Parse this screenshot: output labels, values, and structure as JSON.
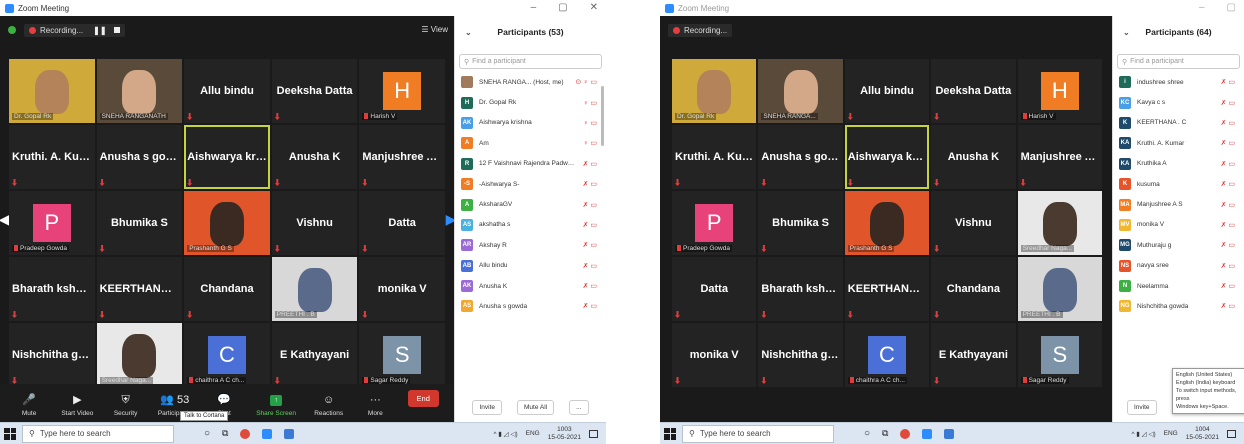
{
  "colors": {
    "accent": "#2d8cff",
    "end": "#d0382d",
    "active_speaker": "#c5d33c",
    "muted": "#e23b3b",
    "share": "#24a148"
  },
  "left": {
    "title": "Zoom Meeting",
    "recording": "Recording...",
    "view": "View",
    "participants_title": "Participants (53)",
    "search_placeholder": "Find a participant",
    "grid": [
      {
        "kind": "photo",
        "label": "Dr. Gopal Rk",
        "bg": "#cfa93a",
        "face": "#b5835a"
      },
      {
        "kind": "photo",
        "label": "SNEHA RANGANATH",
        "bg": "#5a4a3a",
        "face": "#d3a888"
      },
      {
        "kind": "name",
        "name": "Allu bindu"
      },
      {
        "kind": "name",
        "name": "Deeksha Datta"
      },
      {
        "kind": "avatar",
        "letter": "H",
        "color": "#f07c24",
        "label": "Harish V"
      },
      {
        "kind": "name",
        "name": "Kruthi. A. Kumar"
      },
      {
        "kind": "name",
        "name": "Anusha s gowda"
      },
      {
        "kind": "name",
        "name": "Aishwarya krish...",
        "active": true
      },
      {
        "kind": "name",
        "name": "Anusha K"
      },
      {
        "kind": "name",
        "name": "Manjushree A S"
      },
      {
        "kind": "avatar",
        "letter": "P",
        "color": "#e8427a",
        "label": "Pradeep Gowda"
      },
      {
        "kind": "name",
        "name": "Bhumika S"
      },
      {
        "kind": "photo",
        "label": "Prashanth G S",
        "bg": "#e0562a",
        "face": "#3a2a22"
      },
      {
        "kind": "name",
        "name": "Vishnu"
      },
      {
        "kind": "name",
        "name": "Datta"
      },
      {
        "kind": "name",
        "name": "Bharath kshatri..."
      },
      {
        "kind": "name",
        "name": "KEERTHANA . C"
      },
      {
        "kind": "name",
        "name": "Chandana"
      },
      {
        "kind": "photo",
        "label": "PREETHI . B",
        "bg": "#d8d8d8",
        "face": "#5a6a8a"
      },
      {
        "kind": "name",
        "name": "monika V"
      },
      {
        "kind": "name",
        "name": "Nishchitha gow..."
      },
      {
        "kind": "photo",
        "label": "Sreedhar Naga...",
        "bg": "#e8e8e8",
        "face": "#4a3a30"
      },
      {
        "kind": "avatar",
        "letter": "C",
        "color": "#4a6fd6",
        "label": "chaithra A C ch..."
      },
      {
        "kind": "name",
        "name": "E Kathyayani"
      },
      {
        "kind": "avatar",
        "letter": "S",
        "color": "#7d93a8",
        "label": "Sagar Reddy"
      }
    ],
    "toolbar": [
      {
        "icon": "🎤",
        "label": "Mute"
      },
      {
        "icon": "▶",
        "label": "Start Video"
      },
      {
        "icon": "⛨",
        "label": "Security"
      },
      {
        "icon": "👥 53",
        "label": "Participants"
      },
      {
        "icon": "💬",
        "label": "Chat"
      },
      {
        "icon": "↑",
        "label": "Share Screen"
      },
      {
        "icon": "☺",
        "label": "Reactions"
      },
      {
        "icon": "···",
        "label": "More"
      }
    ],
    "end": "End",
    "tooltip": "Talk to Cortana",
    "participants": [
      {
        "initials": "",
        "color": "#a07a5a",
        "name": "SNEHA RANGA... (Host, me)",
        "icons": "⊙ ♀ ▭"
      },
      {
        "initials": "H",
        "color": "#1f6b5a",
        "name": "Dr. Gopal Rk",
        "icons": "♀ ▭"
      },
      {
        "initials": "AK",
        "color": "#4a9ee8",
        "name": "Aishwarya krishna",
        "icons": "♀ ▭"
      },
      {
        "initials": "A",
        "color": "#f07c24",
        "name": "Am",
        "icons": "♀ ▭"
      },
      {
        "initials": "R",
        "color": "#1f6b5a",
        "name": "12 F Vaishnavi Rajendra Padwa...",
        "icons": "✗ ▭"
      },
      {
        "initials": "-S",
        "color": "#f07c24",
        "name": "-Aishwarya S-",
        "icons": "✗ ▭"
      },
      {
        "initials": "A",
        "color": "#3cb043",
        "name": "AksharaGV",
        "icons": "✗ ▭"
      },
      {
        "initials": "AS",
        "color": "#4ab0e0",
        "name": "akshatha s",
        "icons": "✗ ▭"
      },
      {
        "initials": "AR",
        "color": "#9a6ad6",
        "name": "Akshay R",
        "icons": "✗ ▭"
      },
      {
        "initials": "AB",
        "color": "#4a6fd6",
        "name": "Allu bindu",
        "icons": "✗ ▭"
      },
      {
        "initials": "AK",
        "color": "#9a6ad6",
        "name": "Anusha K",
        "icons": "✗ ▭"
      },
      {
        "initials": "AS",
        "color": "#f0a830",
        "name": "Anusha s gowda",
        "icons": "✗ ▭"
      }
    ],
    "invite": "Invite",
    "mute_all": "Mute All",
    "more": "...",
    "taskbar_search": "Type here to search",
    "lang": "ENG",
    "time": "1003",
    "date": "15-05-2021"
  },
  "right": {
    "title": "Zoom Meeting",
    "recording": "Recording...",
    "participants_title": "Participants (64)",
    "search_placeholder": "Find a participant",
    "grid": [
      {
        "kind": "photo",
        "label": "Dr. Gopal Rk",
        "bg": "#cfa93a",
        "face": "#b5835a"
      },
      {
        "kind": "photo",
        "label": "SNEHA RANGA...",
        "bg": "#5a4a3a",
        "face": "#d3a888"
      },
      {
        "kind": "name",
        "name": "Allu bindu"
      },
      {
        "kind": "name",
        "name": "Deeksha Datta"
      },
      {
        "kind": "avatar",
        "letter": "H",
        "color": "#f07c24",
        "label": "Harish V"
      },
      {
        "kind": "name",
        "name": "Kruthi. A. Kumar"
      },
      {
        "kind": "name",
        "name": "Anusha s gowda"
      },
      {
        "kind": "name",
        "name": "Aishwarya krish...",
        "active": true
      },
      {
        "kind": "name",
        "name": "Anusha K"
      },
      {
        "kind": "name",
        "name": "Manjushree A S"
      },
      {
        "kind": "avatar",
        "letter": "P",
        "color": "#e8427a",
        "label": "Pradeep Gowda"
      },
      {
        "kind": "name",
        "name": "Bhumika S"
      },
      {
        "kind": "photo",
        "label": "Prashanth G S",
        "bg": "#e0562a",
        "face": "#3a2a22"
      },
      {
        "kind": "name",
        "name": "Vishnu"
      },
      {
        "kind": "photo",
        "label": "Sreedhar Naga...",
        "bg": "#e8e8e8",
        "face": "#4a3a30"
      },
      {
        "kind": "name",
        "name": "Datta"
      },
      {
        "kind": "name",
        "name": "Bharath kshatri..."
      },
      {
        "kind": "name",
        "name": "KEERTHANA . C"
      },
      {
        "kind": "name",
        "name": "Chandana"
      },
      {
        "kind": "photo",
        "label": "PREETHI . B",
        "bg": "#d8d8d8",
        "face": "#5a6a8a"
      },
      {
        "kind": "name",
        "name": "monika V"
      },
      {
        "kind": "name",
        "name": "Nishchitha gow..."
      },
      {
        "kind": "avatar",
        "letter": "C",
        "color": "#4a6fd6",
        "label": "chaithra A C ch..."
      },
      {
        "kind": "name",
        "name": "E Kathyayani"
      },
      {
        "kind": "avatar",
        "letter": "S",
        "color": "#7d93a8",
        "label": "Sagar Reddy"
      }
    ],
    "participants": [
      {
        "initials": "i",
        "color": "#1f6b5a",
        "name": "indushree shree",
        "icons": "✗ ▭"
      },
      {
        "initials": "KC",
        "color": "#4a9ee8",
        "name": "Kavya c s",
        "icons": "✗ ▭"
      },
      {
        "initials": "K",
        "color": "#1f4a6b",
        "name": "KEERTHANA . C",
        "icons": "✗ ▭"
      },
      {
        "initials": "KA",
        "color": "#1f4a6b",
        "name": "Kruthi. A. Kumar",
        "icons": "✗ ▭"
      },
      {
        "initials": "KA",
        "color": "#1f4a6b",
        "name": "Kruthika A",
        "icons": "✗ ▭"
      },
      {
        "initials": "K",
        "color": "#e8542a",
        "name": "kusuma",
        "icons": "✗ ▭"
      },
      {
        "initials": "MA",
        "color": "#f07c24",
        "name": "Manjushree A S",
        "icons": "✗ ▭"
      },
      {
        "initials": "MV",
        "color": "#f0b830",
        "name": "monika V",
        "icons": "✗ ▭"
      },
      {
        "initials": "MG",
        "color": "#1f4a6b",
        "name": "Muthuraju g",
        "icons": "✗ ▭"
      },
      {
        "initials": "NS",
        "color": "#e8542a",
        "name": "navya sree",
        "icons": "✗ ▭"
      },
      {
        "initials": "N",
        "color": "#3cb043",
        "name": "Neelamma",
        "icons": "✗ ▭"
      },
      {
        "initials": "NG",
        "color": "#f0b830",
        "name": "Nishchitha gowda",
        "icons": "✗ ▭"
      }
    ],
    "invite": "Invite",
    "ime_lines": [
      "English (United States)",
      "English (India) keyboard",
      "To switch input methods, press",
      "Windows key+Space."
    ],
    "taskbar_search": "Type here to search",
    "lang": "ENG",
    "time": "1004",
    "date": "15-05-2021"
  }
}
